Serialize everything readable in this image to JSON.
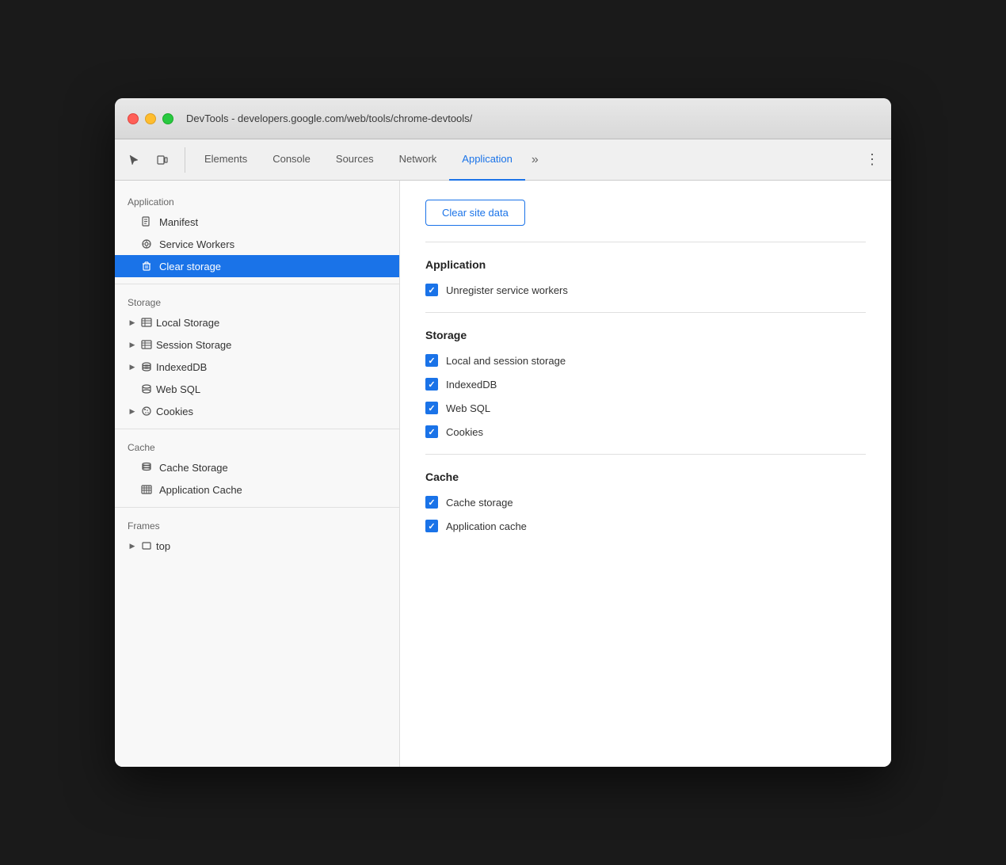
{
  "window": {
    "title": "DevTools - developers.google.com/web/tools/chrome-devtools/"
  },
  "toolbar": {
    "tabs": [
      {
        "id": "elements",
        "label": "Elements",
        "active": false
      },
      {
        "id": "console",
        "label": "Console",
        "active": false
      },
      {
        "id": "sources",
        "label": "Sources",
        "active": false
      },
      {
        "id": "network",
        "label": "Network",
        "active": false
      },
      {
        "id": "application",
        "label": "Application",
        "active": true
      }
    ],
    "more_label": "»",
    "menu_label": "⋮"
  },
  "sidebar": {
    "sections": [
      {
        "id": "application",
        "header": "Application",
        "items": [
          {
            "id": "manifest",
            "label": "Manifest",
            "icon": "manifest",
            "indent": true
          },
          {
            "id": "service-workers",
            "label": "Service Workers",
            "icon": "gear",
            "indent": true
          },
          {
            "id": "clear-storage",
            "label": "Clear storage",
            "icon": "trash",
            "indent": true,
            "active": true
          }
        ]
      },
      {
        "id": "storage",
        "header": "Storage",
        "items": [
          {
            "id": "local-storage",
            "label": "Local Storage",
            "icon": "table",
            "hasArrow": true,
            "indent": false
          },
          {
            "id": "session-storage",
            "label": "Session Storage",
            "icon": "table",
            "hasArrow": true,
            "indent": false
          },
          {
            "id": "indexeddb",
            "label": "IndexedDB",
            "icon": "db",
            "hasArrow": true,
            "indent": false
          },
          {
            "id": "web-sql",
            "label": "Web SQL",
            "icon": "db",
            "indent": false
          },
          {
            "id": "cookies",
            "label": "Cookies",
            "icon": "cookie",
            "hasArrow": true,
            "indent": false
          }
        ]
      },
      {
        "id": "cache",
        "header": "Cache",
        "items": [
          {
            "id": "cache-storage",
            "label": "Cache Storage",
            "icon": "stack",
            "indent": true
          },
          {
            "id": "application-cache",
            "label": "Application Cache",
            "icon": "grid",
            "indent": true
          }
        ]
      },
      {
        "id": "frames",
        "header": "Frames",
        "items": [
          {
            "id": "top",
            "label": "top",
            "icon": "frame",
            "hasArrow": true,
            "indent": false
          }
        ]
      }
    ]
  },
  "content": {
    "clear_button_label": "Clear site data",
    "sections": [
      {
        "id": "application",
        "title": "Application",
        "checkboxes": [
          {
            "id": "unregister-sw",
            "label": "Unregister service workers",
            "checked": true
          }
        ]
      },
      {
        "id": "storage",
        "title": "Storage",
        "checkboxes": [
          {
            "id": "local-session",
            "label": "Local and session storage",
            "checked": true
          },
          {
            "id": "indexeddb",
            "label": "IndexedDB",
            "checked": true
          },
          {
            "id": "web-sql",
            "label": "Web SQL",
            "checked": true
          },
          {
            "id": "cookies",
            "label": "Cookies",
            "checked": true
          }
        ]
      },
      {
        "id": "cache",
        "title": "Cache",
        "checkboxes": [
          {
            "id": "cache-storage",
            "label": "Cache storage",
            "checked": true
          },
          {
            "id": "app-cache",
            "label": "Application cache",
            "checked": true
          }
        ]
      }
    ]
  }
}
